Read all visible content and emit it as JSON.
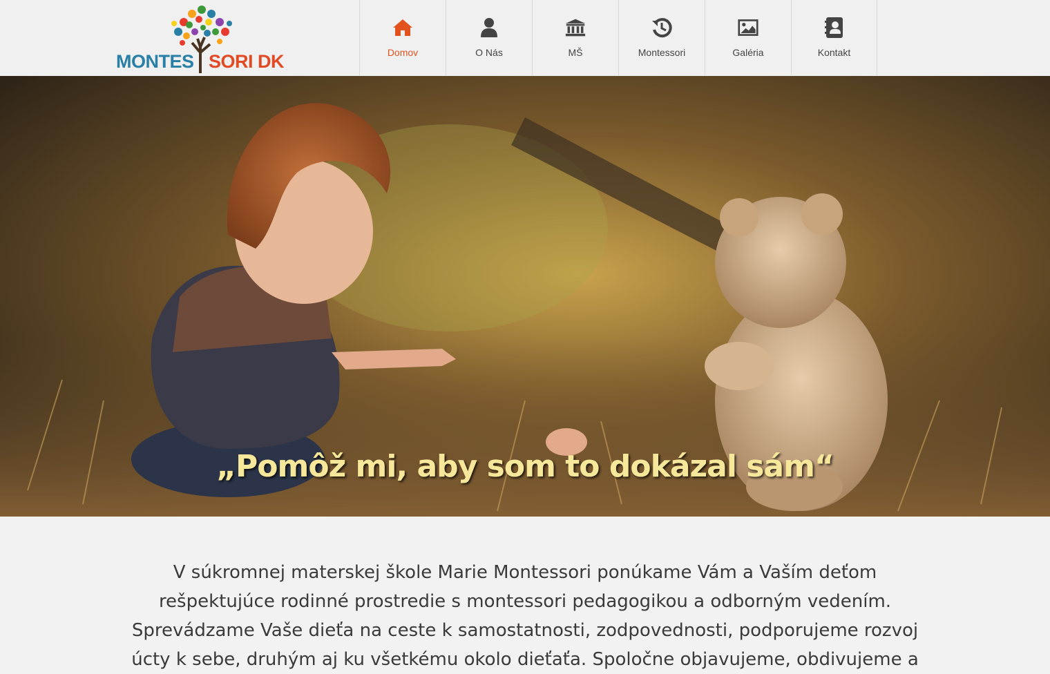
{
  "logo": {
    "text_left": "MONTES",
    "text_right": "SORI DK",
    "colors": {
      "left": "#2a7fa6",
      "right": "#e04a25"
    }
  },
  "nav": {
    "items": [
      {
        "label": "Domov",
        "icon": "home-icon",
        "active": true
      },
      {
        "label": "O Nás",
        "icon": "user-icon",
        "active": false
      },
      {
        "label": "MŠ",
        "icon": "institution-icon",
        "active": false
      },
      {
        "label": "Montessori",
        "icon": "history-icon",
        "active": false
      },
      {
        "label": "Galéria",
        "icon": "picture-icon",
        "active": false
      },
      {
        "label": "Kontakt",
        "icon": "contact-book-icon",
        "active": false
      }
    ],
    "colors": {
      "active": "#e2521e",
      "icon": "#444444"
    }
  },
  "hero": {
    "quote": "„Pomôž mi, aby som to dokázal sám“"
  },
  "intro": {
    "lines": [
      "V súkromnej materskej škole Marie Montessori ponúkame Vám a Vaším deťom",
      "rešpektujúce rodinné prostredie s montessori pedagogikou a odborným vedením.",
      "Sprevádzame Vaše dieťa na ceste k samostatnosti, zodpovednosti, podporujeme rozvoj",
      "úcty k sebe, druhým aj ku všetkému okolo dieťaťa. Spoločne objavujeme, obdivujeme a"
    ]
  }
}
